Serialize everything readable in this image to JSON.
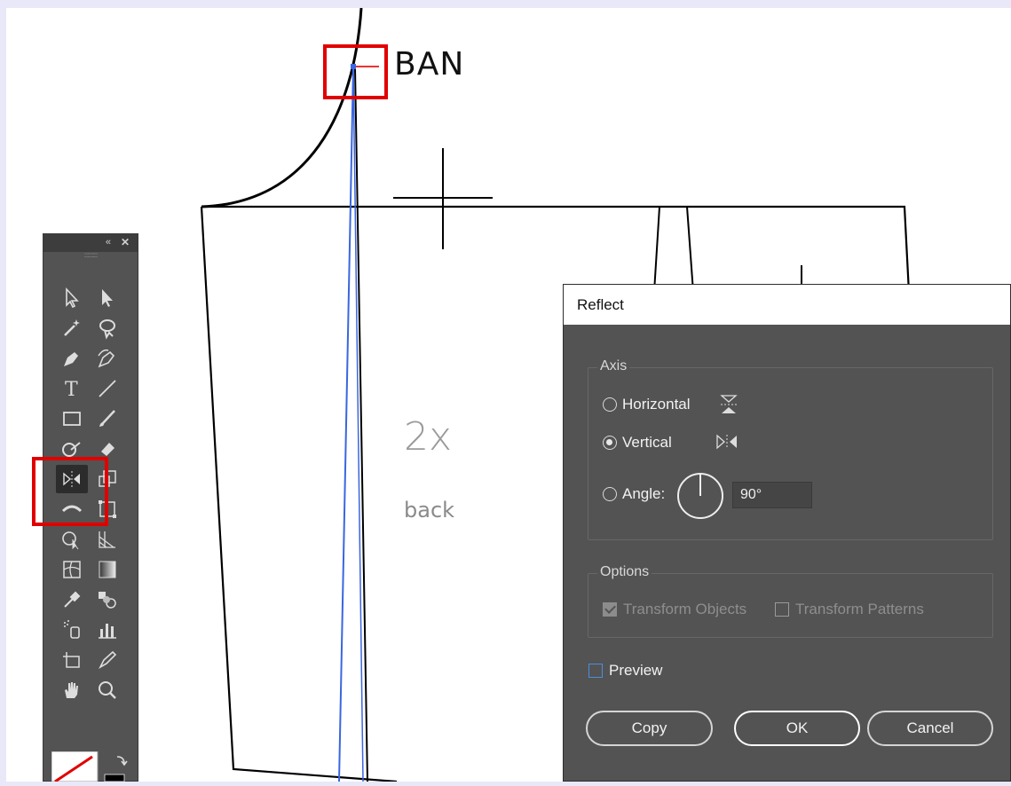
{
  "artboard": {
    "label_ban": "BAN",
    "label_2x": "2x",
    "label_back": "back"
  },
  "tools_panel": {
    "collapse_glyph": "«",
    "close_glyph": "✕",
    "tools": [
      "selection-tool",
      "direct-selection-tool",
      "magic-wand-tool",
      "lasso-tool",
      "pen-tool",
      "curvature-tool",
      "type-tool",
      "line-segment-tool",
      "rectangle-tool",
      "paintbrush-tool",
      "shaper-tool",
      "eraser-tool",
      "reflect-tool",
      "scale-tool",
      "width-tool",
      "free-transform-tool",
      "shape-builder-tool",
      "perspective-grid-tool",
      "mesh-tool",
      "gradient-tool",
      "eyedropper-tool",
      "blend-tool",
      "symbol-sprayer-tool",
      "column-graph-tool",
      "artboard-tool",
      "slice-tool",
      "hand-tool",
      "zoom-tool"
    ],
    "active_tool": "reflect-tool"
  },
  "dialog": {
    "title": "Reflect",
    "axis_label": "Axis",
    "horizontal_label": "Horizontal",
    "vertical_label": "Vertical",
    "angle_label": "Angle:",
    "angle_value": "90°",
    "selected_axis": "vertical",
    "options_label": "Options",
    "transform_objects_label": "Transform Objects",
    "transform_objects_checked": true,
    "transform_patterns_label": "Transform Patterns",
    "transform_patterns_checked": false,
    "preview_label": "Preview",
    "preview_checked": false,
    "copy_label": "Copy",
    "ok_label": "OK",
    "cancel_label": "Cancel"
  },
  "colors": {
    "highlight": "#e00000",
    "path_selected": "#3a66e0",
    "panel_bg": "#535353"
  }
}
